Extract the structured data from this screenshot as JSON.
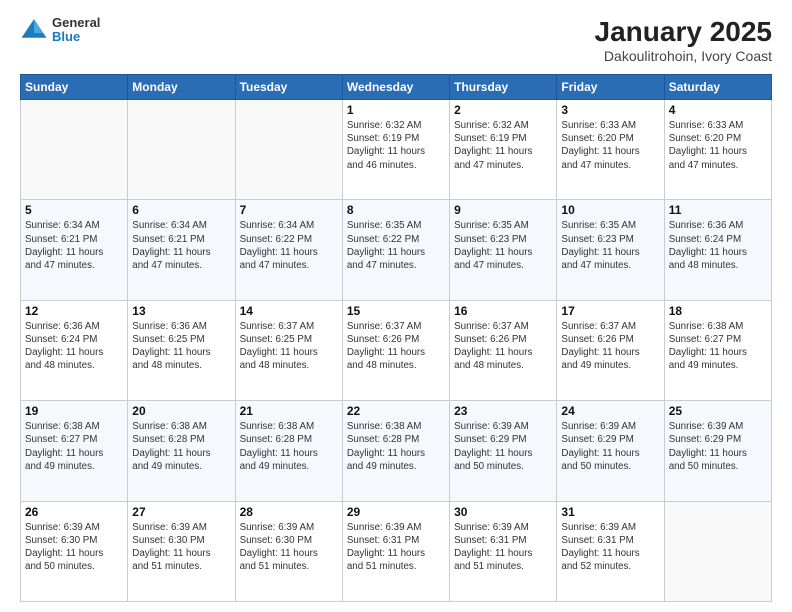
{
  "header": {
    "logo": {
      "general": "General",
      "blue": "Blue"
    },
    "title": "January 2025",
    "location": "Dakoulitrohoin, Ivory Coast"
  },
  "weekdays": [
    "Sunday",
    "Monday",
    "Tuesday",
    "Wednesday",
    "Thursday",
    "Friday",
    "Saturday"
  ],
  "weeks": [
    [
      {
        "day": "",
        "info": ""
      },
      {
        "day": "",
        "info": ""
      },
      {
        "day": "",
        "info": ""
      },
      {
        "day": "1",
        "info": "Sunrise: 6:32 AM\nSunset: 6:19 PM\nDaylight: 11 hours\nand 46 minutes."
      },
      {
        "day": "2",
        "info": "Sunrise: 6:32 AM\nSunset: 6:19 PM\nDaylight: 11 hours\nand 47 minutes."
      },
      {
        "day": "3",
        "info": "Sunrise: 6:33 AM\nSunset: 6:20 PM\nDaylight: 11 hours\nand 47 minutes."
      },
      {
        "day": "4",
        "info": "Sunrise: 6:33 AM\nSunset: 6:20 PM\nDaylight: 11 hours\nand 47 minutes."
      }
    ],
    [
      {
        "day": "5",
        "info": "Sunrise: 6:34 AM\nSunset: 6:21 PM\nDaylight: 11 hours\nand 47 minutes."
      },
      {
        "day": "6",
        "info": "Sunrise: 6:34 AM\nSunset: 6:21 PM\nDaylight: 11 hours\nand 47 minutes."
      },
      {
        "day": "7",
        "info": "Sunrise: 6:34 AM\nSunset: 6:22 PM\nDaylight: 11 hours\nand 47 minutes."
      },
      {
        "day": "8",
        "info": "Sunrise: 6:35 AM\nSunset: 6:22 PM\nDaylight: 11 hours\nand 47 minutes."
      },
      {
        "day": "9",
        "info": "Sunrise: 6:35 AM\nSunset: 6:23 PM\nDaylight: 11 hours\nand 47 minutes."
      },
      {
        "day": "10",
        "info": "Sunrise: 6:35 AM\nSunset: 6:23 PM\nDaylight: 11 hours\nand 47 minutes."
      },
      {
        "day": "11",
        "info": "Sunrise: 6:36 AM\nSunset: 6:24 PM\nDaylight: 11 hours\nand 48 minutes."
      }
    ],
    [
      {
        "day": "12",
        "info": "Sunrise: 6:36 AM\nSunset: 6:24 PM\nDaylight: 11 hours\nand 48 minutes."
      },
      {
        "day": "13",
        "info": "Sunrise: 6:36 AM\nSunset: 6:25 PM\nDaylight: 11 hours\nand 48 minutes."
      },
      {
        "day": "14",
        "info": "Sunrise: 6:37 AM\nSunset: 6:25 PM\nDaylight: 11 hours\nand 48 minutes."
      },
      {
        "day": "15",
        "info": "Sunrise: 6:37 AM\nSunset: 6:26 PM\nDaylight: 11 hours\nand 48 minutes."
      },
      {
        "day": "16",
        "info": "Sunrise: 6:37 AM\nSunset: 6:26 PM\nDaylight: 11 hours\nand 48 minutes."
      },
      {
        "day": "17",
        "info": "Sunrise: 6:37 AM\nSunset: 6:26 PM\nDaylight: 11 hours\nand 49 minutes."
      },
      {
        "day": "18",
        "info": "Sunrise: 6:38 AM\nSunset: 6:27 PM\nDaylight: 11 hours\nand 49 minutes."
      }
    ],
    [
      {
        "day": "19",
        "info": "Sunrise: 6:38 AM\nSunset: 6:27 PM\nDaylight: 11 hours\nand 49 minutes."
      },
      {
        "day": "20",
        "info": "Sunrise: 6:38 AM\nSunset: 6:28 PM\nDaylight: 11 hours\nand 49 minutes."
      },
      {
        "day": "21",
        "info": "Sunrise: 6:38 AM\nSunset: 6:28 PM\nDaylight: 11 hours\nand 49 minutes."
      },
      {
        "day": "22",
        "info": "Sunrise: 6:38 AM\nSunset: 6:28 PM\nDaylight: 11 hours\nand 49 minutes."
      },
      {
        "day": "23",
        "info": "Sunrise: 6:39 AM\nSunset: 6:29 PM\nDaylight: 11 hours\nand 50 minutes."
      },
      {
        "day": "24",
        "info": "Sunrise: 6:39 AM\nSunset: 6:29 PM\nDaylight: 11 hours\nand 50 minutes."
      },
      {
        "day": "25",
        "info": "Sunrise: 6:39 AM\nSunset: 6:29 PM\nDaylight: 11 hours\nand 50 minutes."
      }
    ],
    [
      {
        "day": "26",
        "info": "Sunrise: 6:39 AM\nSunset: 6:30 PM\nDaylight: 11 hours\nand 50 minutes."
      },
      {
        "day": "27",
        "info": "Sunrise: 6:39 AM\nSunset: 6:30 PM\nDaylight: 11 hours\nand 51 minutes."
      },
      {
        "day": "28",
        "info": "Sunrise: 6:39 AM\nSunset: 6:30 PM\nDaylight: 11 hours\nand 51 minutes."
      },
      {
        "day": "29",
        "info": "Sunrise: 6:39 AM\nSunset: 6:31 PM\nDaylight: 11 hours\nand 51 minutes."
      },
      {
        "day": "30",
        "info": "Sunrise: 6:39 AM\nSunset: 6:31 PM\nDaylight: 11 hours\nand 51 minutes."
      },
      {
        "day": "31",
        "info": "Sunrise: 6:39 AM\nSunset: 6:31 PM\nDaylight: 11 hours\nand 52 minutes."
      },
      {
        "day": "",
        "info": ""
      }
    ]
  ]
}
